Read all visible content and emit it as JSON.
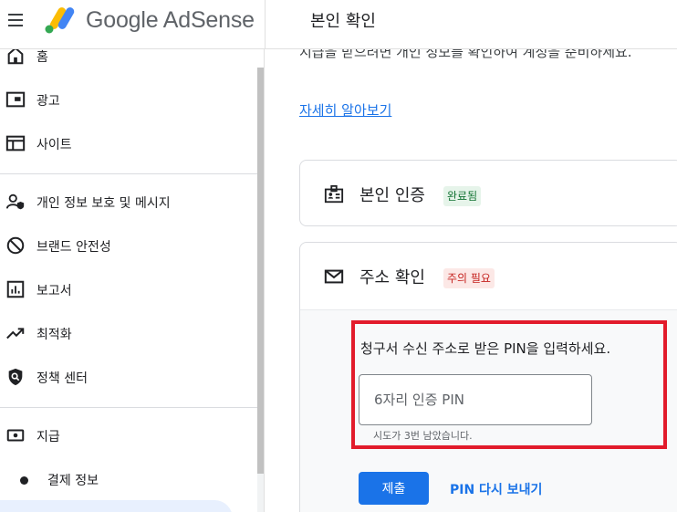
{
  "header": {
    "brand": "Google AdSense",
    "page_title": "본인 확인"
  },
  "sidebar": {
    "items": [
      {
        "label": "홈",
        "icon": "home-icon"
      },
      {
        "label": "광고",
        "icon": "ads-icon"
      },
      {
        "label": "사이트",
        "icon": "sites-icon"
      },
      {
        "label": "개인 정보 보호 및 메시지",
        "icon": "privacy-icon"
      },
      {
        "label": "브랜드 안전성",
        "icon": "block-icon"
      },
      {
        "label": "보고서",
        "icon": "reports-icon"
      },
      {
        "label": "최적화",
        "icon": "trending-icon"
      },
      {
        "label": "정책 센터",
        "icon": "policy-icon"
      },
      {
        "label": "지급",
        "icon": "payments-icon"
      },
      {
        "label": "결제 정보",
        "icon": "dot-icon"
      }
    ]
  },
  "main": {
    "intro_text": "지급을 받으려면 개인 정보를 확인하여 계정을 준비하세요.",
    "learn_more": "자세히 알아보기",
    "identity_card": {
      "title": "본인 인증",
      "badge": "완료됨",
      "icon": "id-card-icon"
    },
    "address_card": {
      "title": "주소 확인",
      "badge": "주의 필요",
      "icon": "mail-icon",
      "instruction": "청구서 수신 주소로 받은 PIN을 입력하세요.",
      "pin_placeholder": "6자리 인증 PIN",
      "pin_value": "",
      "attempts_hint": "시도가 3번 남았습니다.",
      "submit_label": "제출",
      "resend_label": "PIN 다시 보내기"
    }
  },
  "colors": {
    "accent": "#1a73e8",
    "success_bg": "#e6f4ea",
    "warning_bg": "#fce8e6",
    "highlight_border": "#e21b2b"
  }
}
